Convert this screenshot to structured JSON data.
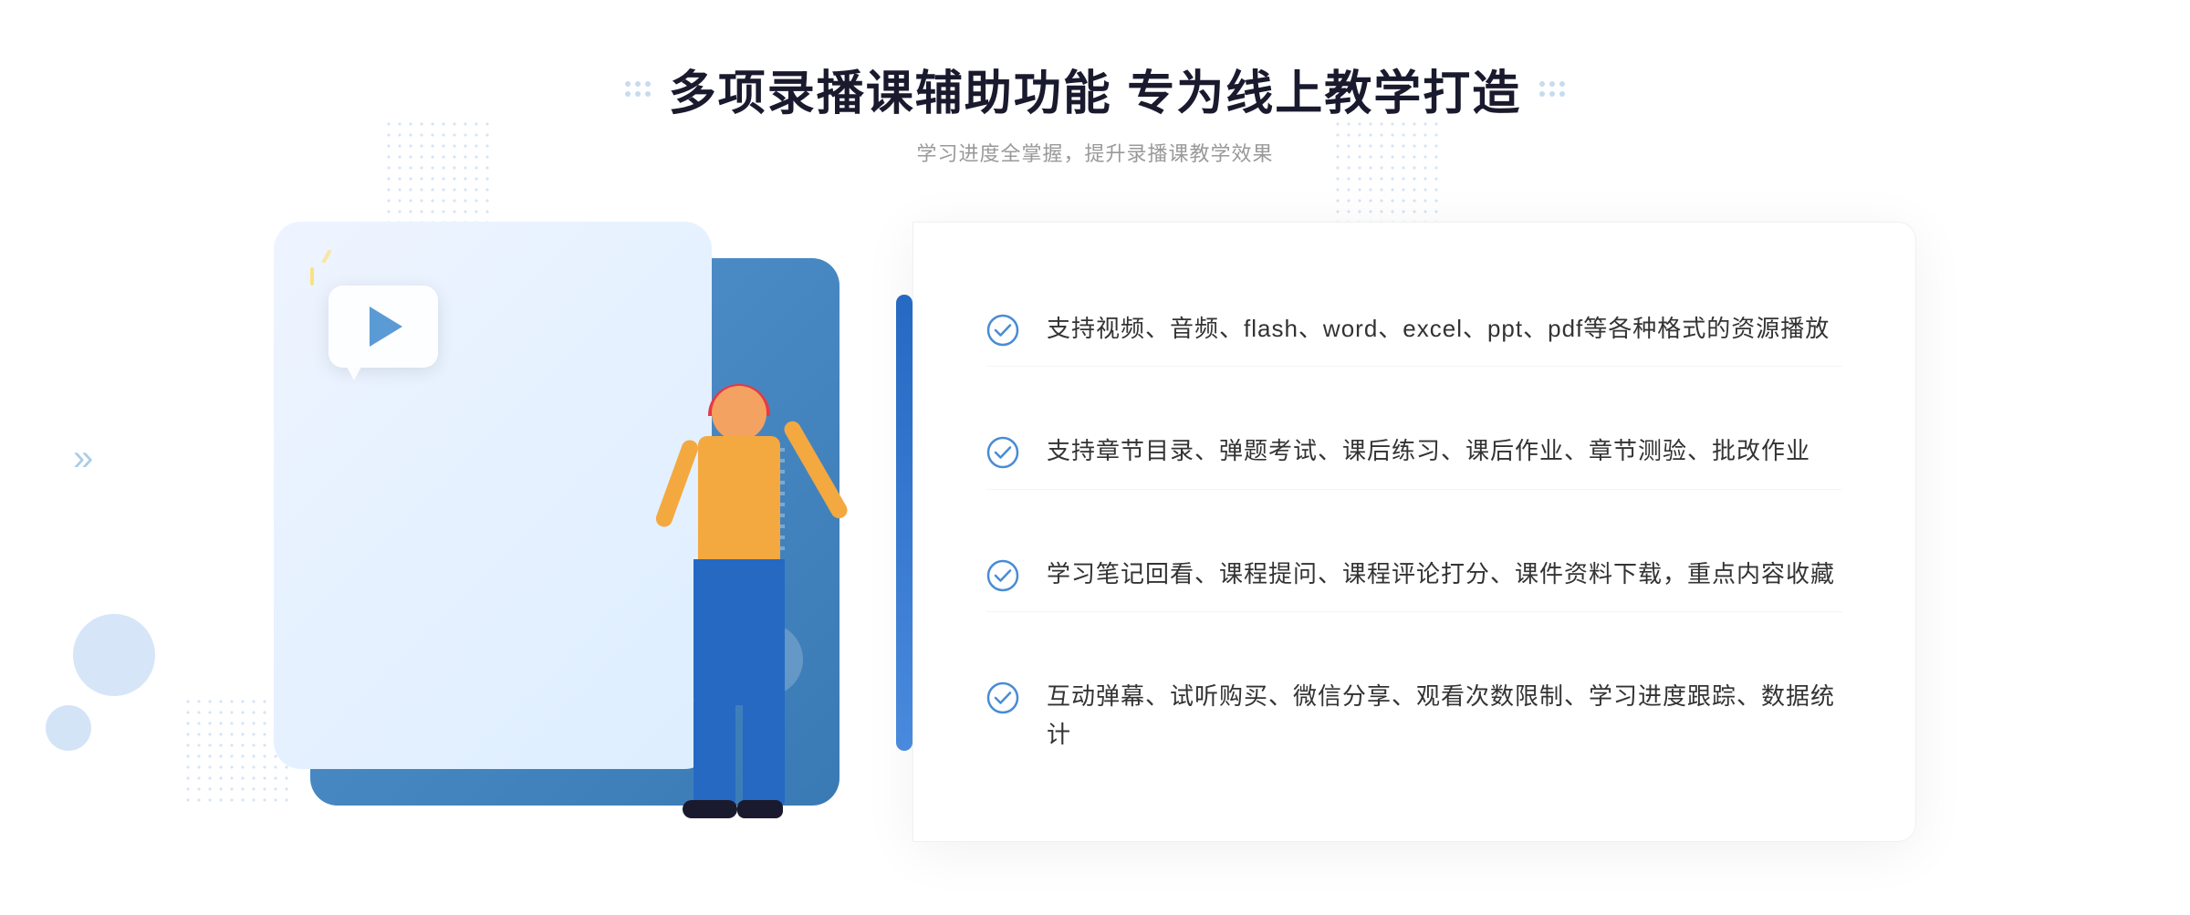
{
  "header": {
    "title": "多项录播课辅助功能 专为线上教学打造",
    "subtitle": "学习进度全掌握，提升录播课教学效果"
  },
  "features": [
    {
      "id": 1,
      "text": "支持视频、音频、flash、word、excel、ppt、pdf等各种格式的资源播放"
    },
    {
      "id": 2,
      "text": "支持章节目录、弹题考试、课后练习、课后作业、章节测验、批改作业"
    },
    {
      "id": 3,
      "text": "学习笔记回看、课程提问、课程评论打分、课件资料下载，重点内容收藏"
    },
    {
      "id": 4,
      "text": "互动弹幕、试听购买、微信分享、观看次数限制、学习进度跟踪、数据统计"
    }
  ],
  "icons": {
    "check": "check-circle-icon",
    "double_chevron": "»",
    "play": "▶"
  },
  "colors": {
    "primary_blue": "#4a8cd4",
    "dark_blue": "#2569c3",
    "light_blue_bg": "#eef4ff",
    "text_dark": "#333333",
    "text_gray": "#999999",
    "accent_orange": "#f4a840"
  }
}
